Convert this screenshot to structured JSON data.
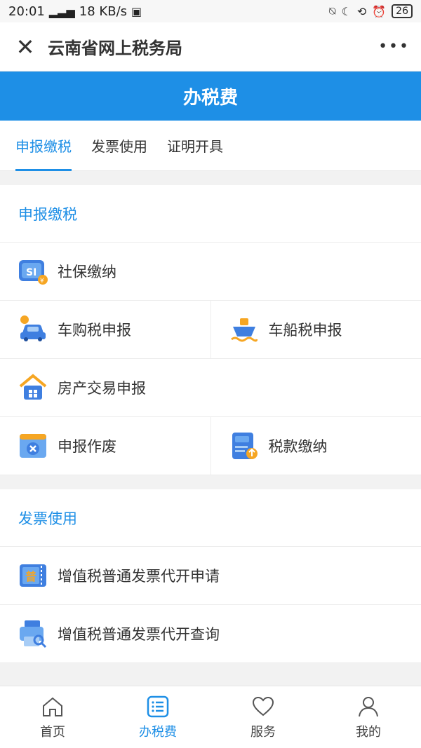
{
  "status": {
    "time": "20:01",
    "network_speed": "18 KB/s",
    "battery": "26"
  },
  "app": {
    "title": "云南省网上税务局"
  },
  "page": {
    "header": "办税费"
  },
  "tabs": [
    {
      "label": "申报缴税"
    },
    {
      "label": "发票使用"
    },
    {
      "label": "证明开具"
    }
  ],
  "sections": [
    {
      "title": "申报缴税",
      "items": [
        {
          "label": "社保缴纳"
        },
        {
          "label": "车购税申报"
        },
        {
          "label": "车船税申报"
        },
        {
          "label": "房产交易申报"
        },
        {
          "label": "申报作废"
        },
        {
          "label": "税款缴纳"
        }
      ]
    },
    {
      "title": "发票使用",
      "items": [
        {
          "label": "增值税普通发票代开申请"
        },
        {
          "label": "增值税普通发票代开查询"
        }
      ]
    }
  ],
  "bottom_nav": [
    {
      "label": "首页"
    },
    {
      "label": "办税费"
    },
    {
      "label": "服务"
    },
    {
      "label": "我的"
    }
  ],
  "colors": {
    "primary": "#1e8fe6",
    "background": "#f2f2f2"
  }
}
